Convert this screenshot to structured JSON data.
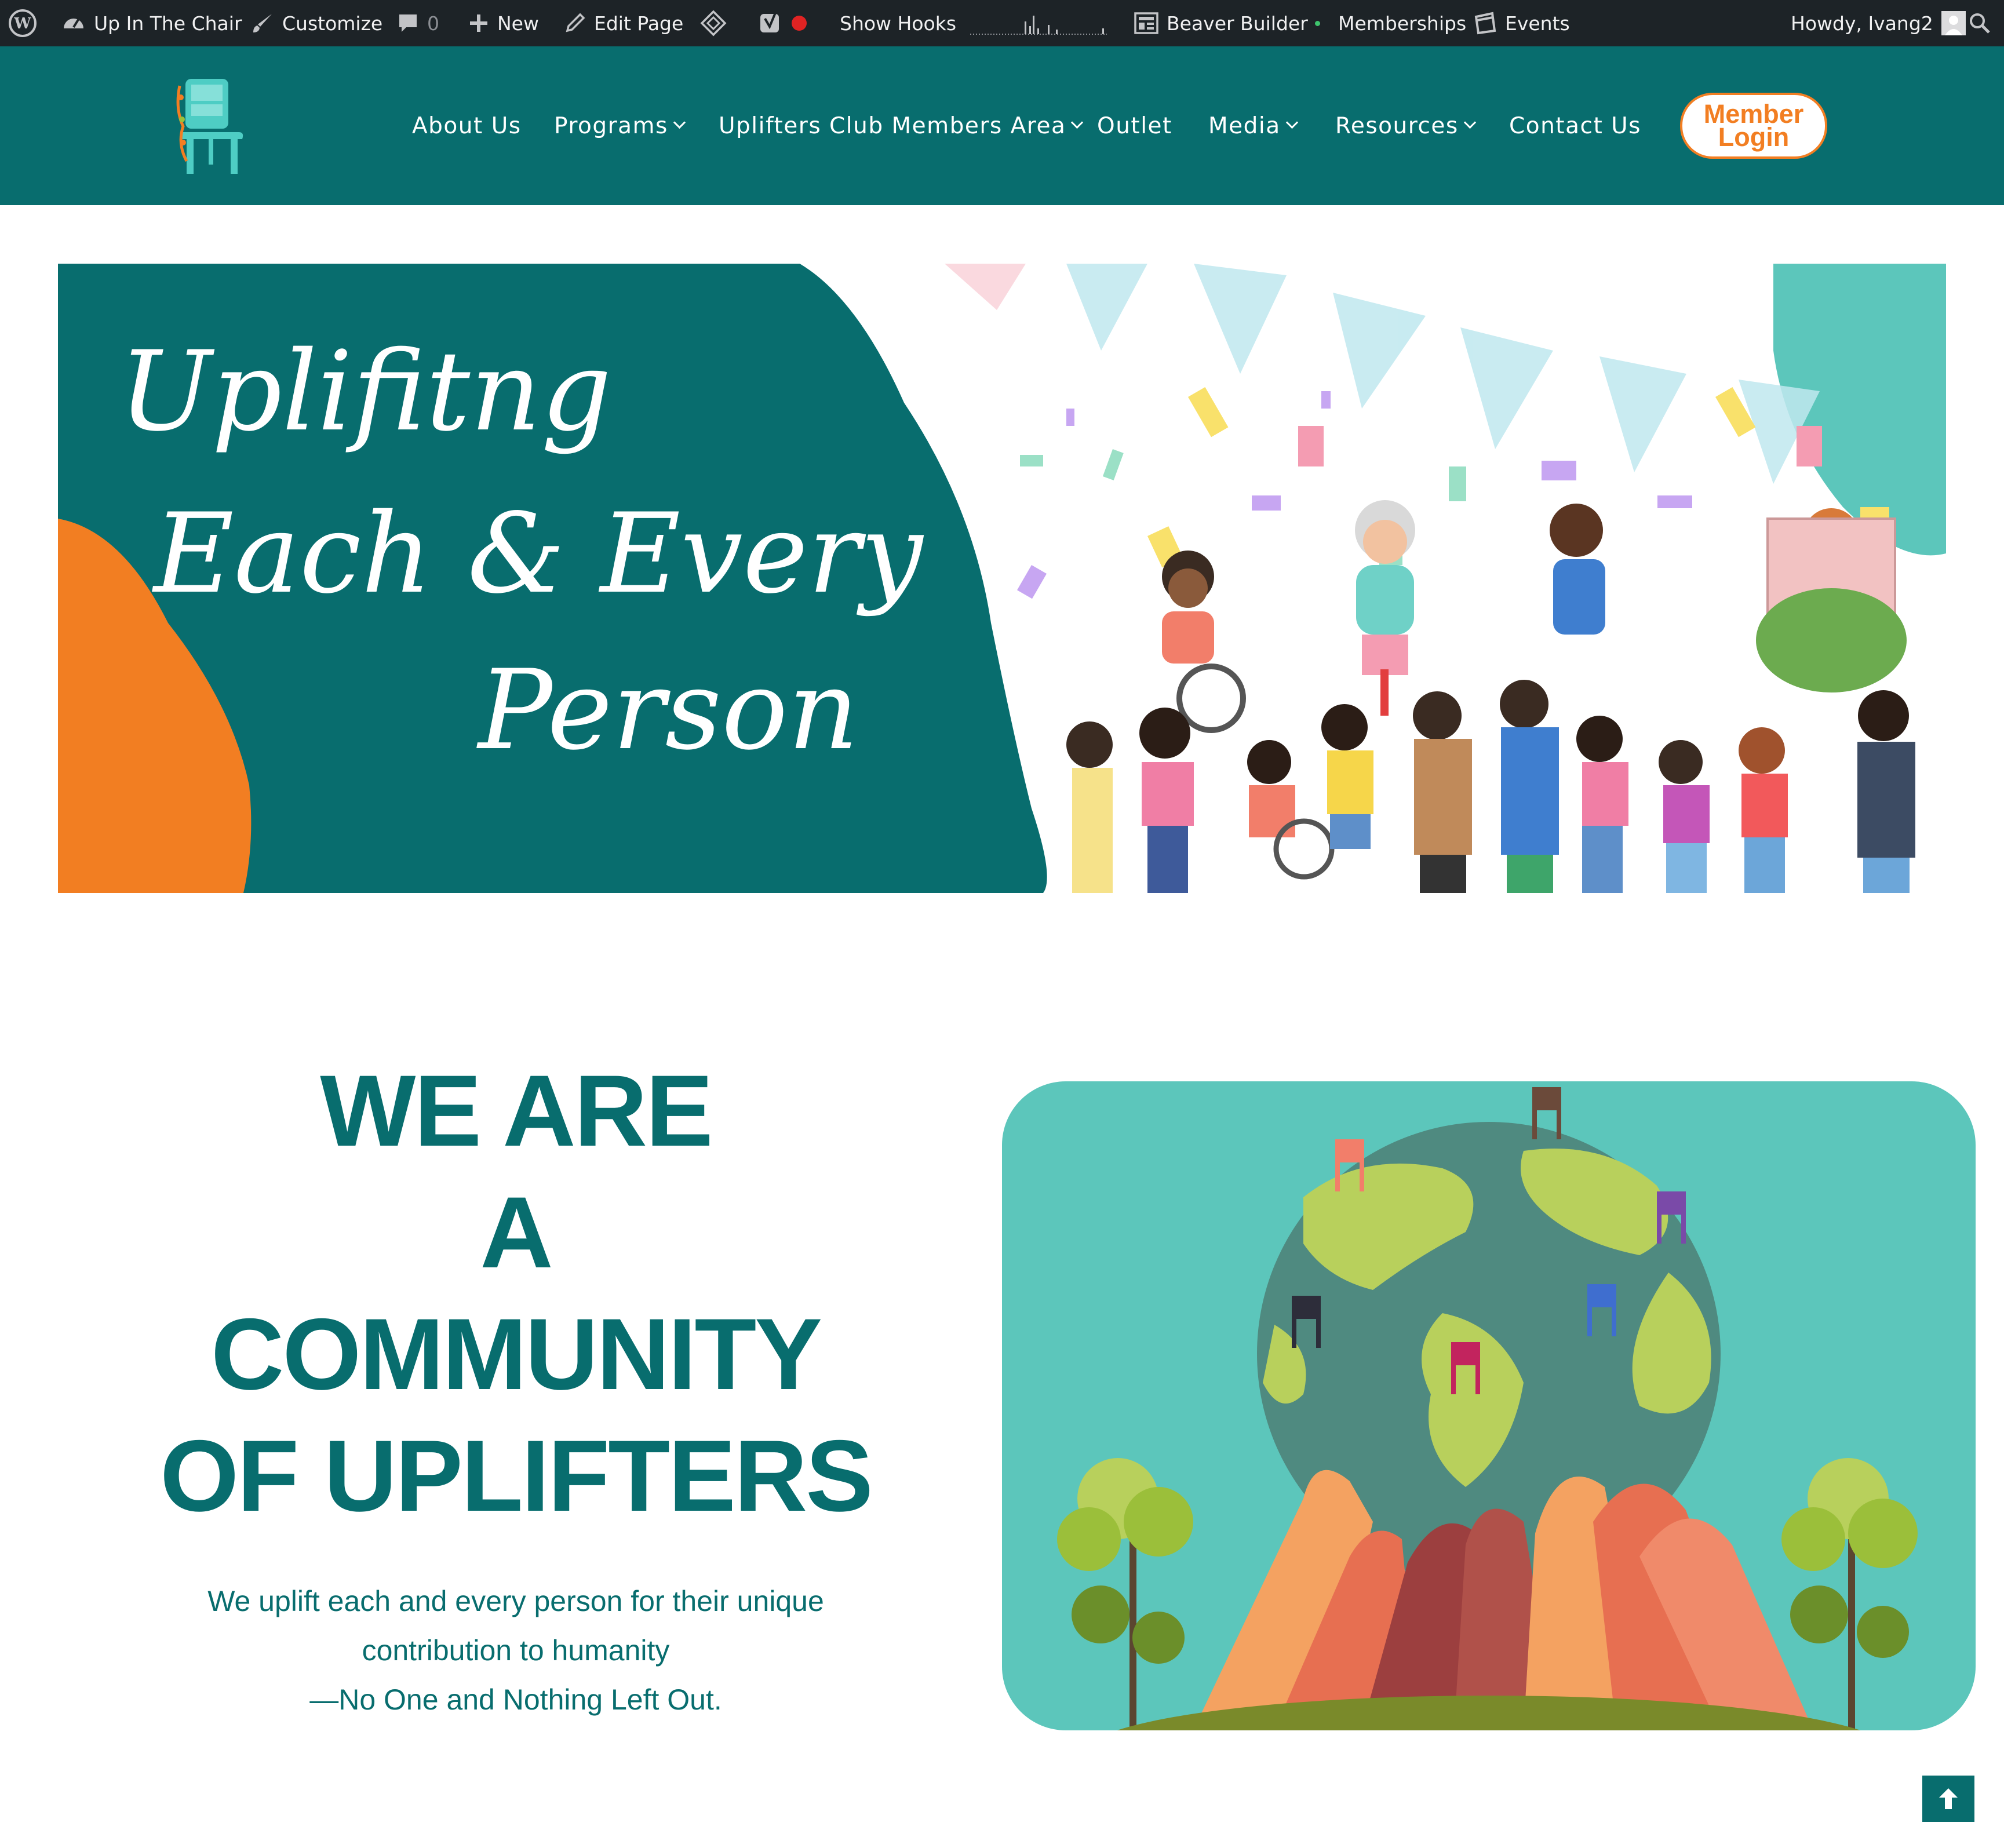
{
  "admin_bar": {
    "site_name": "Up In The Chair",
    "customize": "Customize",
    "comments_count": "0",
    "new": "New",
    "edit_page": "Edit Page",
    "show_hooks": "Show Hooks",
    "beaver_builder": "Beaver Builder",
    "memberships": "Memberships",
    "events": "Events",
    "howdy": "Howdy, Ivang2",
    "icons": [
      "wordpress-icon",
      "dashboard-icon",
      "brush-icon",
      "comment-icon",
      "plus-icon",
      "pencil-icon",
      "diamond-icon",
      "yoast-icon",
      "record-icon",
      "graph-icon",
      "builder-icon",
      "calendar-icon",
      "avatar-icon",
      "search-icon"
    ]
  },
  "header": {
    "logo_alt": "Up In The Chair logo",
    "nav": [
      {
        "label": "About Us",
        "dropdown": false
      },
      {
        "label": "Programs",
        "dropdown": true
      },
      {
        "label": "Uplifters Club Members Area",
        "dropdown": true
      },
      {
        "label": "Outlet",
        "dropdown": false
      },
      {
        "label": "Media",
        "dropdown": true
      },
      {
        "label": "Resources",
        "dropdown": true
      },
      {
        "label": "Contact Us",
        "dropdown": false
      }
    ],
    "member_login": {
      "line1": "Member",
      "line2": "Login"
    }
  },
  "hero": {
    "line1": "Uplifitng",
    "line2": "Each & Every",
    "line3": "Person"
  },
  "community": {
    "headline": [
      "WE ARE",
      "A",
      "COMMUNITY",
      "OF UPLIFTERS"
    ],
    "subtext": [
      "We uplift each and every person for their unique",
      "contribution to humanity",
      "—No One and Nothing Left Out."
    ]
  },
  "colors": {
    "teal": "#086d6e",
    "orange": "#f27e22",
    "admin_bar": "#1d2327",
    "globe_bg": "#5cc6bb"
  }
}
